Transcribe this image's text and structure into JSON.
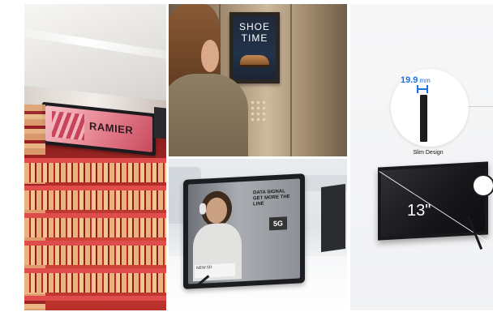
{
  "panels": {
    "retail_shelf": {
      "screen_text": "RAMIER"
    },
    "elevator": {
      "poster_line1": "SHOE",
      "poster_line2": "TIME"
    },
    "tablet_display": {
      "headline": "DATA SIGNAL GET MORE THE LINE",
      "network_badge": "5G",
      "footer": "NEW 5D"
    },
    "product": {
      "thickness_value": "19.9",
      "thickness_unit": "mm",
      "feature_label": "Slim Design",
      "screen_size": "13\""
    }
  },
  "colors": {
    "accent_blue": "#1a6fe6",
    "device_black": "#19191c"
  },
  "icons": [
    "lens-circle-icon"
  ]
}
